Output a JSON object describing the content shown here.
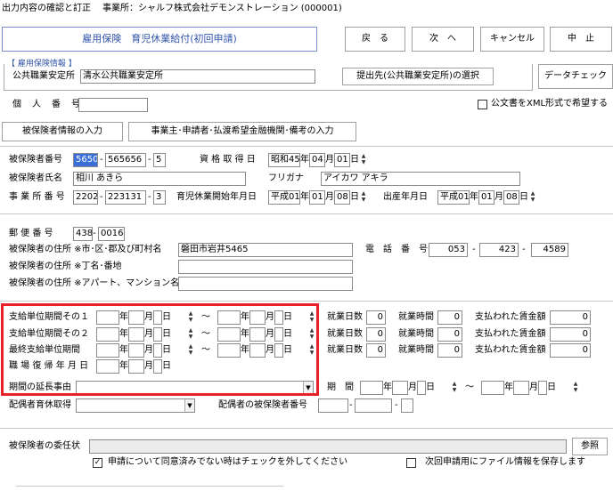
{
  "header": {
    "title": "出力内容の確認と訂正",
    "office": "事業所：シャルフ株式会社デモンストレーション (000001)"
  },
  "form": {
    "title": "雇用保険　育児休業給付(初回申請)"
  },
  "toolbar": {
    "back": "戻　る",
    "next": "次　へ",
    "cancel": "キャンセル",
    "stop": "中　止"
  },
  "employment": {
    "group_label": "【 雇用保険情報 】",
    "office_label": "公共職業安定所",
    "office_value": "清水公共職業安定所",
    "select_button": "提出先(公共職業安定所)の選択",
    "data_check": "データチェック"
  },
  "personal_no_label": "個　人　番　号",
  "xml_checkbox_label": "公文書をXML形式で希望する",
  "section_buttons": {
    "insured": "被保険者情報の入力",
    "employer": "事業主･申請者･払渡希望金融機関･備考の入力"
  },
  "insured": {
    "no_label": "被保険者番号",
    "no": [
      "5650",
      "565656",
      "5"
    ],
    "qual_label": "資 格 取 得 日",
    "qual_date": {
      "era": "昭和45",
      "year_unit": "年",
      "month": "04",
      "month_unit": "月",
      "day": "01",
      "day_unit": "日"
    },
    "name_label": "被保険者氏名",
    "name": "相川 あきら",
    "furigana_label": "フリガナ",
    "furigana": "アイカワ アキラ",
    "office_no_label": "事 業 所 番 号",
    "office_no": [
      "2202",
      "223131",
      "3"
    ],
    "leave_start_label": "育児休業開始年月日",
    "leave_start": {
      "era": "平成01",
      "year_unit": "年",
      "month": "01",
      "month_unit": "月",
      "day": "08",
      "day_unit": "日"
    },
    "birth_label": "出産年月日",
    "birth": {
      "era": "平成01",
      "year_unit": "年",
      "month": "01",
      "month_unit": "月",
      "day": "08",
      "day_unit": "日"
    }
  },
  "address": {
    "postal_label": "郵 便 番 号",
    "postal": [
      "438",
      "0016"
    ],
    "addr1_label": "被保険者の住所 ※市･区･郡及び町村名",
    "addr1": "磐田市岩井5465",
    "addr2_label": "被保険者の住所 ※丁名･番地",
    "addr2": "",
    "addr3_label": "被保険者の住所 ※アパート、マンション名等",
    "addr3": "",
    "phone_label": "電　話　番　号",
    "phone": [
      "053",
      "423",
      "4589"
    ]
  },
  "periods": {
    "rows": [
      {
        "label": "支給単位期間その１",
        "work_days_label": "就業日数",
        "work_days": "0",
        "work_hours_label": "就業時間",
        "work_hours": "0",
        "paid_label": "支払われた賃金額",
        "paid": "0"
      },
      {
        "label": "支給単位期間その２",
        "work_days_label": "就業日数",
        "work_days": "0",
        "work_hours_label": "就業時間",
        "work_hours": "0",
        "paid_label": "支払われた賃金額",
        "paid": "0"
      },
      {
        "label": "最終支給単位期間",
        "work_days_label": "就業日数",
        "work_days": "0",
        "work_hours_label": "就業時間",
        "work_hours": "0",
        "paid_label": "支払われた賃金額",
        "paid": "0"
      }
    ],
    "return_label": "職 場 復 帰 年 月 日",
    "extension_label": "期間の延長事由",
    "extension_value": "",
    "period_label": "期　間",
    "tilde": "～",
    "year_unit": "年",
    "month_unit": "月",
    "day_unit": "日"
  },
  "spouse": {
    "leave_label": "配偶者育休取得",
    "leave_value": "",
    "insured_no_label": "配偶者の被保険者番号"
  },
  "delegation": {
    "label": "被保険者の委任状",
    "value": "",
    "browse": "参照",
    "consent_label": "申請について同意済みでない時はチェックを外してください",
    "consent_checked": "✓",
    "save_label": "次回申請用にファイル情報を保存します"
  },
  "colors": {
    "highlight": "#e8202a",
    "title_text": "#3355aa",
    "title_border": "#7a8fd0",
    "selection": "#3a6fd8"
  }
}
